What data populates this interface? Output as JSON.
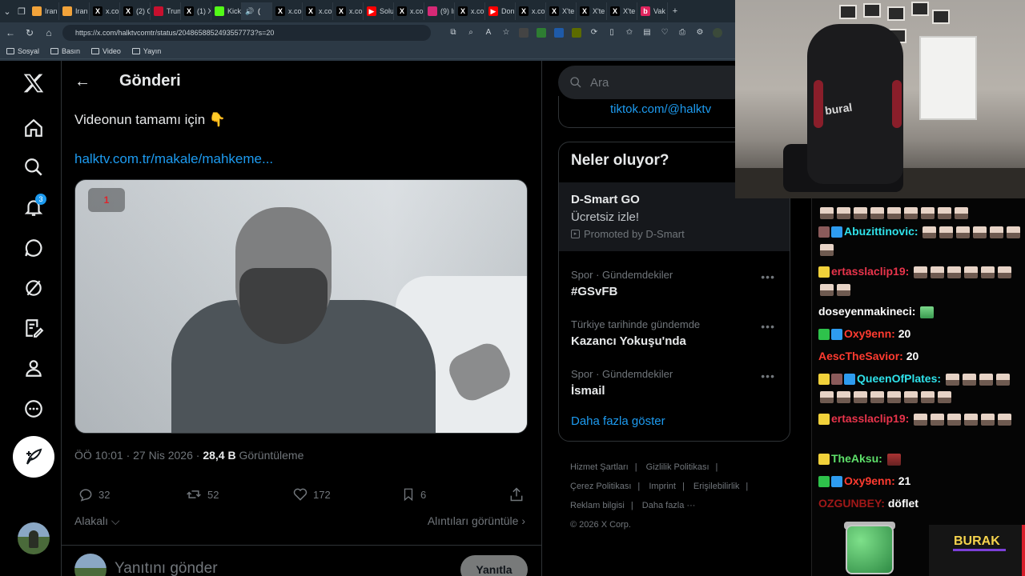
{
  "browser": {
    "tabs": [
      {
        "label": "Iran",
        "fav_color": "#f2a33a",
        "fav_glyph": ""
      },
      {
        "label": "Iran",
        "fav_color": "#f2a33a",
        "fav_glyph": ""
      },
      {
        "label": "x.cor",
        "fav_color": "#000000",
        "fav_glyph": "X"
      },
      {
        "label": "(2) G",
        "fav_color": "#000000",
        "fav_glyph": "X"
      },
      {
        "label": "Trum",
        "fav_color": "#c8102e",
        "fav_glyph": ""
      },
      {
        "label": "(1) X",
        "fav_color": "#000000",
        "fav_glyph": "X"
      },
      {
        "label": "Kick",
        "fav_color": "#53fc18",
        "fav_glyph": ""
      },
      {
        "label": "(",
        "fav_color": "#2c3945",
        "fav_glyph": "🔊",
        "active": true
      },
      {
        "label": "x.cor",
        "fav_color": "#000000",
        "fav_glyph": "X"
      },
      {
        "label": "x.cor",
        "fav_color": "#000000",
        "fav_glyph": "X"
      },
      {
        "label": "x.cor",
        "fav_color": "#000000",
        "fav_glyph": "X"
      },
      {
        "label": "Solu",
        "fav_color": "#ff0000",
        "fav_glyph": "▶"
      },
      {
        "label": "x.cor",
        "fav_color": "#000000",
        "fav_glyph": "X"
      },
      {
        "label": "(9) Ir",
        "fav_color": "#d62976",
        "fav_glyph": ""
      },
      {
        "label": "x.cor",
        "fav_color": "#000000",
        "fav_glyph": "X"
      },
      {
        "label": "Don",
        "fav_color": "#ff0000",
        "fav_glyph": "▶"
      },
      {
        "label": "x.cor",
        "fav_color": "#000000",
        "fav_glyph": "X"
      },
      {
        "label": "X'te",
        "fav_color": "#000000",
        "fav_glyph": "X"
      },
      {
        "label": "X'te",
        "fav_color": "#000000",
        "fav_glyph": "X"
      },
      {
        "label": "X'te",
        "fav_color": "#000000",
        "fav_glyph": "X"
      },
      {
        "label": "Vak",
        "fav_color": "#e0245e",
        "fav_glyph": "b"
      }
    ],
    "new_tab": "+",
    "url": "https://x.com/halktvcomtr/status/2048658852493557773?s=20",
    "bookmarks": [
      "Sosyal",
      "Basın",
      "Video",
      "Yayın"
    ]
  },
  "nav": {
    "notification_count": "3"
  },
  "main": {
    "title": "Gönderi",
    "tweet_text": "Videonun tamamı için 👇",
    "tweet_link": "halktv.com.tr/makale/mahkeme...",
    "media_logo": "1",
    "timestamp": "ÖÖ 10:01 · 27 Nis 2026 · ",
    "views_count": "28,4 B",
    "views_label": " Görüntüleme",
    "replies": "32",
    "reposts": "52",
    "likes": "172",
    "bookmarks": "6",
    "related": "Alakalı",
    "quotes": "Alıntıları görüntüle",
    "reply_placeholder": "Yanıtını gönder",
    "reply_button": "Yanıtla"
  },
  "sidebar": {
    "search_placeholder": "Ara",
    "tiktok_link": "tiktok.com/@halktv",
    "trends_title": "Neler oluyor?",
    "promo": {
      "name": "D-Smart GO",
      "desc": "Ücretsiz izle!",
      "by": "Promoted by D-Smart"
    },
    "trends": [
      {
        "category": "Spor · Gündemdekiler",
        "name": "#GSvFB"
      },
      {
        "category": "Türkiye tarihinde gündemde",
        "name": "Kazancı Yokuşu'nda"
      },
      {
        "category": "Spor · Gündemdekiler",
        "name": "İsmail"
      }
    ],
    "show_more": "Daha fazla göster",
    "footer": {
      "terms": "Hizmet Şartları",
      "privacy": "Gizlilik Politikası",
      "cookies": "Çerez Politikası",
      "imprint": "Imprint",
      "accessibility": "Erişilebilirlik",
      "ads": "Reklam bilgisi",
      "more": "Daha fazla ···",
      "copyright": "© 2026 X Corp."
    }
  },
  "webcam": {
    "chair_logo": "bural"
  },
  "chat": {
    "messages": [
      {
        "user": "",
        "user_color": "#ffffff",
        "text": "",
        "emotes": 9,
        "badges": []
      },
      {
        "user": "Abuzittinovic:",
        "user_color": "#2fe2ea",
        "text": "",
        "emotes": 7,
        "badges": [
          "#8a5a5a",
          "#2e9cf0"
        ]
      },
      {
        "user": "ertasslaclip19:",
        "user_color": "#e8344b",
        "text": "",
        "emotes": 8,
        "badges": [
          "#f1d13a"
        ]
      },
      {
        "user": "doseyenmakineci:",
        "user_color": "#ffffff",
        "text": "",
        "emotes": 1,
        "badges": []
      },
      {
        "user": "Oxy9enn:",
        "user_color": "#ff3b30",
        "text": "20",
        "emotes": 0,
        "badges": [
          "#2ec24b",
          "#2e9cf0"
        ]
      },
      {
        "user": "AescTheSavior:",
        "user_color": "#ff3b30",
        "text": "20",
        "emotes": 0,
        "badges": []
      },
      {
        "user": "QueenOfPlates:",
        "user_color": "#2fe2ea",
        "text": "",
        "emotes": 12,
        "badges": [
          "#f1d13a",
          "#8a5a5a",
          "#2e9cf0"
        ]
      },
      {
        "user": "ertasslaclip19:",
        "user_color": "#e8344b",
        "text": "",
        "emotes": 6,
        "badges": [
          "#f1d13a"
        ]
      },
      {
        "user": "TheAksu:",
        "user_color": "#5ee06a",
        "text": "",
        "emotes": 1,
        "badges": [
          "#f1d13a"
        ]
      },
      {
        "user": "Oxy9enn:",
        "user_color": "#ff3b30",
        "text": "21",
        "emotes": 0,
        "badges": [
          "#2ec24b",
          "#2e9cf0"
        ]
      },
      {
        "user": "OZGUNBEY:",
        "user_color": "#a01818",
        "text": "döflet",
        "emotes": 0,
        "badges": []
      }
    ],
    "overlay_name": "BURAK"
  },
  "colors": {
    "accent": "#1d9bf0",
    "background": "#000000",
    "muted": "#71767b"
  }
}
